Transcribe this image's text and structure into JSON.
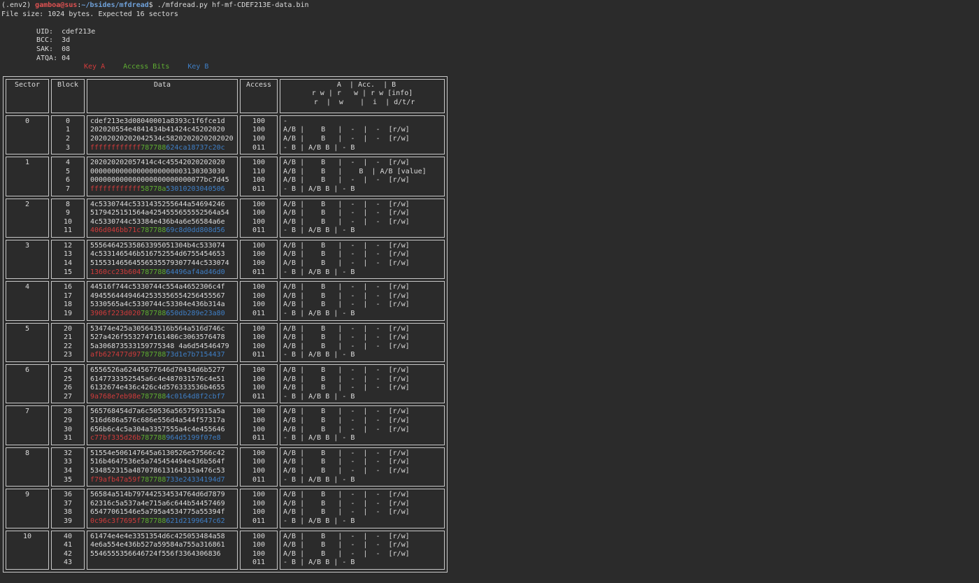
{
  "prompt": {
    "venv": "(.env2) ",
    "user_host": "gamboa@sus",
    "sep": ":",
    "path": "~/bsides/mfdread",
    "dollar": "$ ",
    "command": "./mfdread.py hf-mf-CDEF213E-data.bin"
  },
  "file_size_line": "File size: 1024 bytes. Expected 16 sectors",
  "card_info": [
    "UID:  cdef213e",
    "BCC:  3d",
    "SAK:  08",
    "ATQA: 04"
  ],
  "legend": {
    "key_a": "Key A",
    "access_bits": "Access Bits",
    "key_b": "Key B"
  },
  "colors": {
    "key_a": "#d23c3c",
    "access_bits": "#5fae32",
    "key_b": "#3f7fc6",
    "user": "#e05252",
    "path": "#6fa0d8"
  },
  "table_headers": {
    "sector": "Sector",
    "block": "Block",
    "data": "Data",
    "access": "Access",
    "perm": "  A  | Acc.  | B\nr w | r   w | r w [info]\n r  |  w    |  i  | d/t/r"
  },
  "sectors": [
    {
      "id": "0",
      "blocks": [
        {
          "n": "0",
          "data": "cdef213e3d08040001a8393c1f6fce1d",
          "access": "100",
          "perm": "-"
        },
        {
          "n": "1",
          "data": "202020554e4841434b41424c45202020",
          "access": "100",
          "perm": "A/B |    B   |  -  |  -  [r/w]"
        },
        {
          "n": "2",
          "data": "20202020202042534c5820202020202020",
          "access": "100",
          "perm": "A/B |    B   |  -  |  -  [r/w]"
        }
      ],
      "trailer": {
        "n": "3",
        "key_a": "ffffffffffff",
        "acc": "787788",
        "key_b": "624ca18737c20c",
        "access": "011",
        "perm": "- B | A/B B | - B"
      }
    },
    {
      "id": "1",
      "blocks": [
        {
          "n": "4",
          "data": "202020202057414c4c45542020202020",
          "access": "100",
          "perm": "A/B |    B   |  -  |  -  [r/w]"
        },
        {
          "n": "5",
          "data": "00000000000000000000003130303030",
          "access": "110",
          "perm": "A/B |    B   |    B  | A/B [value]"
        },
        {
          "n": "6",
          "data": "000000000000000000000000077bc7d45",
          "access": "100",
          "perm": "A/B |    B   |  -  |  -  [r/w]"
        }
      ],
      "trailer": {
        "n": "7",
        "key_a": "ffffffffffff",
        "acc": "58778a",
        "key_b": "53010203040506",
        "access": "011",
        "perm": "- B | A/B B | - B"
      }
    },
    {
      "id": "2",
      "blocks": [
        {
          "n": "8",
          "data": "4c5330744c5331435255644a54694246",
          "access": "100",
          "perm": "A/B |    B   |  -  |  -  [r/w]"
        },
        {
          "n": "9",
          "data": "5179425151564a4254555655552564a54",
          "access": "100",
          "perm": "A/B |    B   |  -  |  -  [r/w]"
        },
        {
          "n": "10",
          "data": "4c5330744c53384e436b4a6e56584a6e",
          "access": "100",
          "perm": "A/B |    B   |  -  |  -  [r/w]"
        }
      ],
      "trailer": {
        "n": "11",
        "key_a": "406d046bb71c",
        "acc": "787788",
        "key_b": "69c8d0dd808d56",
        "access": "011",
        "perm": "- B | A/B B | - B"
      }
    },
    {
      "id": "3",
      "blocks": [
        {
          "n": "12",
          "data": "55564642535863395051304b4c533074",
          "access": "100",
          "perm": "A/B |    B   |  -  |  -  [r/w]"
        },
        {
          "n": "13",
          "data": "4c533146546b516752554d6755454653",
          "access": "100",
          "perm": "A/B |    B   |  -  |  -  [r/w]"
        },
        {
          "n": "14",
          "data": "51553146564556535579307744c533074",
          "access": "100",
          "perm": "A/B |    B   |  -  |  -  [r/w]"
        }
      ],
      "trailer": {
        "n": "15",
        "key_a": "1360cc23b604",
        "acc": "787788",
        "key_b": "64496af4ad46d0",
        "access": "011",
        "perm": "- B | A/B B | - B"
      }
    },
    {
      "id": "4",
      "blocks": [
        {
          "n": "16",
          "data": "44516f744c5330744c554a4652306c4f",
          "access": "100",
          "perm": "A/B |    B   |  -  |  -  [r/w]"
        },
        {
          "n": "17",
          "data": "49455644494642535356554256455567",
          "access": "100",
          "perm": "A/B |    B   |  -  |  -  [r/w]"
        },
        {
          "n": "18",
          "data": "5330565a4c5330744c53304e436b314a",
          "access": "100",
          "perm": "A/B |    B   |  -  |  -  [r/w]"
        }
      ],
      "trailer": {
        "n": "19",
        "key_a": "3906f223d020",
        "acc": "787788",
        "key_b": "650db289e23a80",
        "access": "011",
        "perm": "- B | A/B B | - B"
      }
    },
    {
      "id": "5",
      "blocks": [
        {
          "n": "20",
          "data": "53474e425a305643516b564a516d746c",
          "access": "100",
          "perm": "A/B |    B   |  -  |  -  [r/w]"
        },
        {
          "n": "21",
          "data": "527a426f5532747161486c3063576478",
          "access": "100",
          "perm": "A/B |    B   |  -  |  -  [r/w]"
        },
        {
          "n": "22",
          "data": "5a306873533159775348 4a6d54546479",
          "access": "100",
          "perm": "A/B |    B   |  -  |  -  [r/w]"
        }
      ],
      "trailer": {
        "n": "23",
        "key_a": "afb627477d97",
        "acc": "787788",
        "key_b": "73d1e7b7154437",
        "access": "011",
        "perm": "- B | A/B B | - B"
      }
    },
    {
      "id": "6",
      "blocks": [
        {
          "n": "24",
          "data": "6556526a62445677646d70434d6b5277",
          "access": "100",
          "perm": "A/B |    B   |  -  |  -  [r/w]"
        },
        {
          "n": "25",
          "data": "6147733352545a6c4e487031576c4e51",
          "access": "100",
          "perm": "A/B |    B   |  -  |  -  [r/w]"
        },
        {
          "n": "26",
          "data": "6132674e436c426c4d576333536b4655",
          "access": "100",
          "perm": "A/B |    B   |  -  |  -  [r/w]"
        }
      ],
      "trailer": {
        "n": "27",
        "key_a": "9a768e7eb98e",
        "acc": "787788",
        "key_b": "4c0164d8f2cbf7",
        "access": "011",
        "perm": "- B | A/B B | - B"
      }
    },
    {
      "id": "7",
      "blocks": [
        {
          "n": "28",
          "data": "565768454d7a6c50536a565759315a5a",
          "access": "100",
          "perm": "A/B |    B   |  -  |  -  [r/w]"
        },
        {
          "n": "29",
          "data": "516d686a576c686e556d4a544f57317a",
          "access": "100",
          "perm": "A/B |    B   |  -  |  -  [r/w]"
        },
        {
          "n": "30",
          "data": "656b6c4c5a304a3357555a4c4e455646",
          "access": "100",
          "perm": "A/B |    B   |  -  |  -  [r/w]"
        }
      ],
      "trailer": {
        "n": "31",
        "key_a": "c77bf335d26b",
        "acc": "787788",
        "key_b": "964d5199f07e8",
        "access": "011",
        "perm": "- B | A/B B | - B"
      }
    },
    {
      "id": "8",
      "blocks": [
        {
          "n": "32",
          "data": "51554e506147645a6130526e57566c42",
          "access": "100",
          "perm": "A/B |    B   |  -  |  -  [r/w]"
        },
        {
          "n": "33",
          "data": "516b4647536e5a745454494e436b564f",
          "access": "100",
          "perm": "A/B |    B   |  -  |  -  [r/w]"
        },
        {
          "n": "34",
          "data": "534852315a487078613164315a476c53",
          "access": "100",
          "perm": "A/B |    B   |  -  |  -  [r/w]"
        }
      ],
      "trailer": {
        "n": "35",
        "key_a": "f79afb47a59f",
        "acc": "787788",
        "key_b": "733e24334194d7",
        "access": "011",
        "perm": "- B | A/B B | - B"
      }
    },
    {
      "id": "9",
      "blocks": [
        {
          "n": "36",
          "data": "56584a514b797442534534764d6d7879",
          "access": "100",
          "perm": "A/B |    B   |  -  |  -  [r/w]"
        },
        {
          "n": "37",
          "data": "62316c5a537a4e715a6c644b54457469",
          "access": "100",
          "perm": "A/B |    B   |  -  |  -  [r/w]"
        },
        {
          "n": "38",
          "data": "65477061546e5a795a4534775a55394f",
          "access": "100",
          "perm": "A/B |    B   |  -  |  -  [r/w]"
        }
      ],
      "trailer": {
        "n": "39",
        "key_a": "0c96c3f7695f",
        "acc": "787788",
        "key_b": "621d2199647c62",
        "access": "011",
        "perm": "- B | A/B B | - B"
      }
    },
    {
      "id": "10",
      "blocks": [
        {
          "n": "40",
          "data": "61474e4e4e3351354d6c425053484a58",
          "access": "100",
          "perm": "A/B |    B   |  -  |  -  [r/w]"
        },
        {
          "n": "41",
          "data": "4e6a554e436b527a59584a755a316861",
          "access": "100",
          "perm": "A/B |    B   |  -  |  -  [r/w]"
        },
        {
          "n": "42",
          "data": "5546555356646724f556f3364306836",
          "access": "100",
          "perm": "A/B |    B   |  -  |  -  [r/w]"
        }
      ],
      "trailer": {
        "n": "43",
        "key_a": "",
        "acc": "",
        "key_b": "",
        "access": "011",
        "perm": "- B | A/B B | - B"
      }
    }
  ]
}
